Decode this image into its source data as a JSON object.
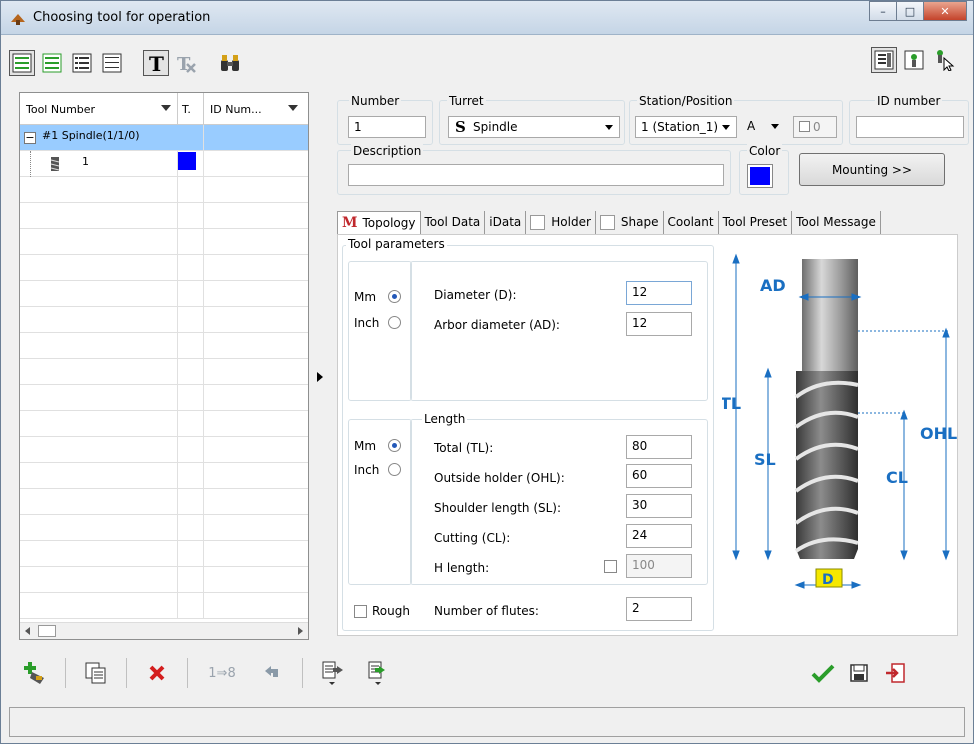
{
  "window": {
    "title": "Choosing tool for operation",
    "controls": {
      "minimize": "–",
      "maximize": "□",
      "close": "✕"
    }
  },
  "tool_tree": {
    "columns": [
      "Tool Number",
      "T.",
      "ID Num..."
    ],
    "rows": [
      {
        "label": "#1 Spindle(1/1/0)",
        "expander": "−"
      },
      {
        "label": "1",
        "color": "#0000ff"
      }
    ]
  },
  "fields": {
    "number_label": "Number",
    "number_value": "1",
    "turret_label": "Turret",
    "turret_glyph": "S",
    "turret_value": "Spindle",
    "station_label": "Station/Position",
    "station_value": "1 (Station_1)",
    "position_value": "A",
    "position_index": "0",
    "id_number_label": "ID number",
    "id_number_value": "",
    "description_label": "Description",
    "description_value": "",
    "color_label": "Color",
    "color_value": "#0000ff",
    "mounting_button": "Mounting >>"
  },
  "tabs": [
    {
      "label": "Topology",
      "icon": "M",
      "active": true
    },
    {
      "label": "Tool Data"
    },
    {
      "label": "iData"
    },
    {
      "label": "Holder",
      "checkbox": true
    },
    {
      "label": "Shape",
      "checkbox": true
    },
    {
      "label": "Coolant"
    },
    {
      "label": "Tool Preset"
    },
    {
      "label": "Tool Message"
    }
  ],
  "tool_parameters": {
    "group_label": "Tool parameters",
    "unit_mm": "Mm",
    "unit_inch": "Inch",
    "diameter_label": "Diameter (D):",
    "diameter_value": "12",
    "arbor_label": "Arbor diameter (AD):",
    "arbor_value": "12"
  },
  "length": {
    "group_label": "Length",
    "unit_mm": "Mm",
    "unit_inch": "Inch",
    "total_label": "Total (TL):",
    "total_value": "80",
    "ohl_label": "Outside holder (OHL):",
    "ohl_value": "60",
    "shoulder_label": "Shoulder length (SL):",
    "shoulder_value": "30",
    "cutting_label": "Cutting (CL):",
    "cutting_value": "24",
    "hlength_label": "H length:",
    "hlength_value": "100"
  },
  "rough_label": "Rough",
  "flutes_label": "Number of flutes:",
  "flutes_value": "2",
  "diagram_labels": {
    "ad": "AD",
    "tl": "TL",
    "sl": "SL",
    "ohl": "OHL",
    "cl": "CL",
    "d": "D"
  },
  "bottom_toolbar": {
    "renumber": "1⇒8"
  }
}
